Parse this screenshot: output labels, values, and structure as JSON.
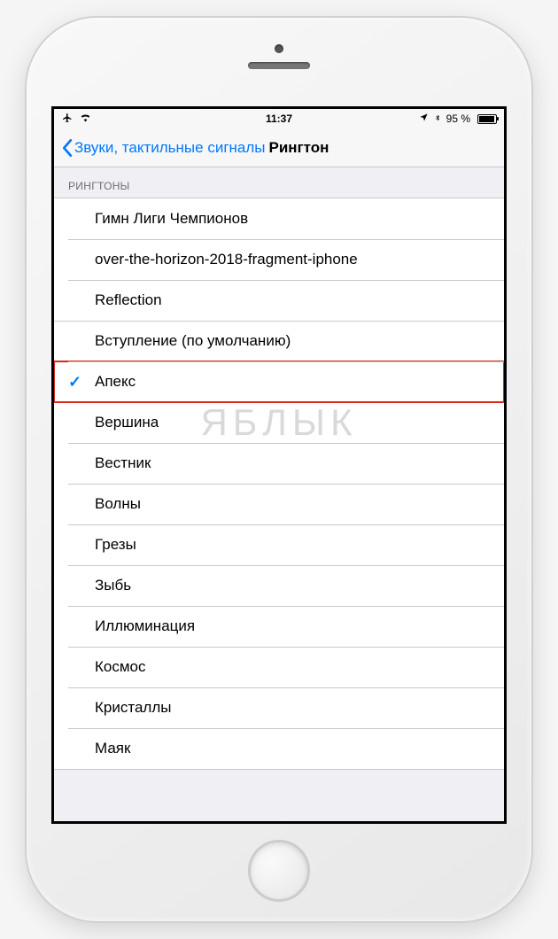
{
  "status": {
    "time": "11:37",
    "battery": "95 %"
  },
  "nav": {
    "back_label": "Звуки, тактильные сигналы",
    "title": "Рингтон"
  },
  "section": {
    "header": "РИНГТОНЫ"
  },
  "ringtones": [
    {
      "label": "Гимн Лиги Чемпионов",
      "selected": false,
      "group_break": false
    },
    {
      "label": "over-the-horizon-2018-fragment-iphone",
      "selected": false,
      "group_break": false
    },
    {
      "label": "Reflection",
      "selected": false,
      "group_break": false
    },
    {
      "label": "Вступление (по умолчанию)",
      "selected": false,
      "group_break": true
    },
    {
      "label": "Апекс",
      "selected": true,
      "group_break": false,
      "highlight": true
    },
    {
      "label": "Вершина",
      "selected": false,
      "group_break": false
    },
    {
      "label": "Вестник",
      "selected": false,
      "group_break": false
    },
    {
      "label": "Волны",
      "selected": false,
      "group_break": false
    },
    {
      "label": "Грезы",
      "selected": false,
      "group_break": false
    },
    {
      "label": "Зыбь",
      "selected": false,
      "group_break": false
    },
    {
      "label": "Иллюминация",
      "selected": false,
      "group_break": false
    },
    {
      "label": "Космос",
      "selected": false,
      "group_break": false
    },
    {
      "label": "Кристаллы",
      "selected": false,
      "group_break": false
    },
    {
      "label": "Маяк",
      "selected": false,
      "group_break": false
    }
  ],
  "watermark": "ЯБЛЫК"
}
